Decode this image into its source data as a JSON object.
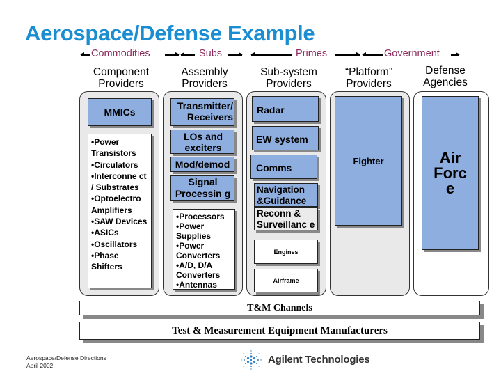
{
  "title": "Aerospace/Defense Example",
  "segments": {
    "commodities": "Commodities",
    "subs": "Subs",
    "primes": "Primes",
    "government": "Government"
  },
  "columns": [
    {
      "header": [
        "Component",
        "Providers"
      ],
      "blue_box": "MMICs",
      "list": [
        "•Power Transistors",
        "•Circulators",
        " •Interconne ct / Substrates",
        "•Optoelectro Amplifiers",
        "•SAW Devices",
        "•ASICs",
        "•Oscillators",
        "•Phase Shifters"
      ]
    },
    {
      "header": [
        "Assembly",
        "Providers"
      ],
      "blue_boxes": [
        "Transmitter/ Receivers",
        "LOs and exciters",
        "Mod/demod",
        "Signal Processin g"
      ],
      "list": [
        "•Processors",
        "•Power Supplies",
        "•Power Converters",
        "•A/D, D/A Converters",
        "•Antennas"
      ]
    },
    {
      "header": [
        "Sub-system",
        "Providers"
      ],
      "blue_boxes": [
        "Radar",
        "EW system",
        "Comms",
        "Navigation &Guidance"
      ],
      "gray_box": "Reconn & Surveillanc e",
      "white_boxes": [
        "Engines",
        "Airframe"
      ]
    },
    {
      "header": [
        "“Platform”",
        "Providers"
      ],
      "blue_box": "Fighter"
    },
    {
      "header": [
        "Defense",
        "Agencies"
      ],
      "blue_box": "Air Forc e"
    }
  ],
  "bands": {
    "channels": "T&M Channels",
    "manufacturers": "Test & Measurement Equipment Manufacturers"
  },
  "footer": {
    "line1": "Aerospace/Defense Directions",
    "line2": "April 2002",
    "brand": "Agilent Technologies",
    "brand_color": "#1a8ed1"
  }
}
